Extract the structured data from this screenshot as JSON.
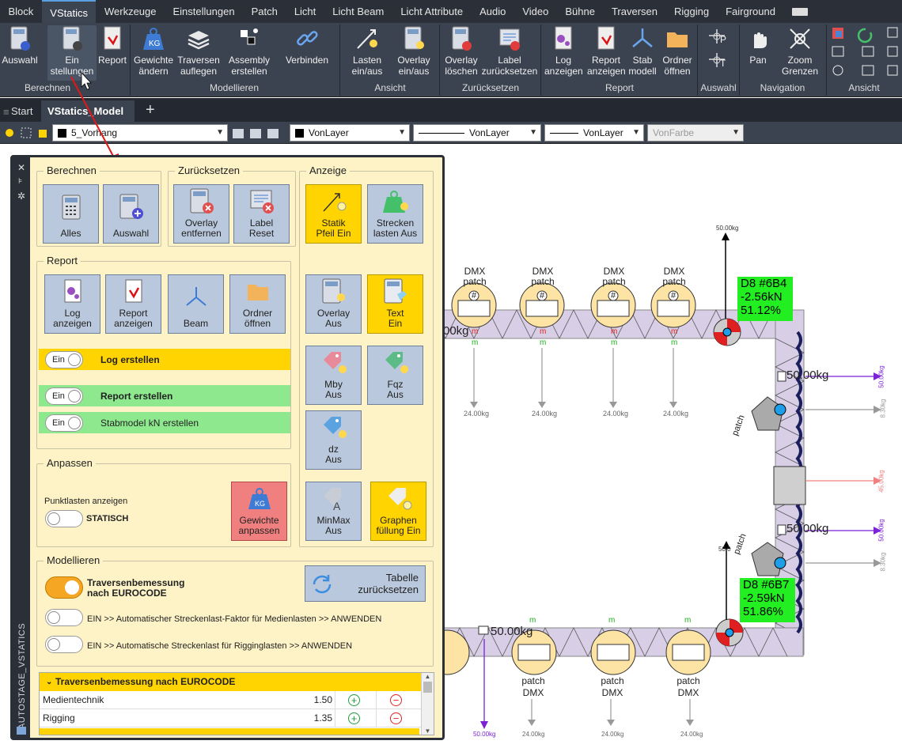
{
  "menu": [
    "Block",
    "VStatics",
    "Werkzeuge",
    "Einstellungen",
    "Patch",
    "Licht",
    "Licht Beam",
    "Licht Attribute",
    "Audio",
    "Video",
    "Bühne",
    "Traversen",
    "Rigging",
    "Fairground"
  ],
  "ribbon": {
    "buttons": [
      "Auswahl",
      "Ein",
      "stellungen",
      "Report",
      "Gewichte",
      "ändern",
      "Traversen",
      "auflegen",
      "Assembly",
      "erstellen",
      "Verbinden",
      "Lasten",
      "ein/aus",
      "Overlay",
      "ein/aus",
      "Overlay",
      "löschen",
      "Label",
      "zurücksetzen",
      "Log",
      "anzeigen",
      "Report",
      "anzeigen",
      "Stab",
      "modell",
      "Ordner",
      "öffnen",
      "Pan",
      "Zoom",
      "Grenzen"
    ],
    "groups": [
      "Berechnen",
      "Modellieren",
      "Ansicht",
      "Zurücksetzen",
      "Report",
      "Auswahl",
      "Navigation",
      "Ansicht"
    ],
    "ribbon_letters": [
      "P",
      "T"
    ]
  },
  "tabs": [
    "Start",
    "VStatics_Model"
  ],
  "propbar": {
    "layer": "5_Vorhang",
    "color": "VonLayer",
    "linetype": "VonLayer",
    "lineweight": "VonLayer",
    "plotcolor": "VonFarbe"
  },
  "panel": {
    "strip_title": "AUTOSTAGE_VSTATICS",
    "legends": [
      "Berechnen",
      "Zurücksetzen",
      "Anzeige",
      "Report",
      "Anpassen",
      "Modellieren"
    ],
    "berechnen": [
      "Alles",
      "Auswahl"
    ],
    "zuruecksetzen": [
      "Overlay",
      "entfernen",
      "Label",
      "Reset"
    ],
    "anzeige": [
      "Statik",
      "Pfeil Ein",
      "Strecken",
      "lasten Aus",
      "Overlay",
      "Aus",
      "Text",
      "Ein",
      "Mby",
      "Aus",
      "Fqz",
      "Aus",
      "dz",
      "Aus",
      "MinMax",
      "Aus",
      "Graphen",
      "füllung Ein"
    ],
    "report": [
      "Log",
      "anzeigen",
      "Report",
      "anzeigen",
      "Beam",
      "Ordner",
      "öffnen"
    ],
    "toggles": [
      {
        "state": "Ein",
        "label": "Log erstellen",
        "color": "#ffd400"
      },
      {
        "state": "Ein",
        "label": "Report erstellen",
        "color": "#8ee88e"
      },
      {
        "state": "Ein",
        "label": "Stabmodel kN erstellen",
        "color": "#8ee88e"
      }
    ],
    "anpassen": {
      "label": "Punktlasten anzeigen",
      "toggle": "STATISCH",
      "button": [
        "Gewichte",
        "anpassen"
      ]
    },
    "modellieren": {
      "trav": [
        "Traversenbemessung",
        "nach EUROCODE"
      ],
      "tabelle": [
        "Tabelle",
        "zurücksetzen"
      ],
      "opt1": "EIN >> Automatischer Streckenlast-Faktor für Medienlasten >> ANWENDEN",
      "opt2": "EIN >> Automatische Streckenlast für Rigginglasten >> ANWENDEN"
    },
    "table": {
      "header": "Traversenbemessung nach EUROCODE",
      "rows": [
        {
          "name": "Medientechnik",
          "value": "1.50"
        },
        {
          "name": "Rigging",
          "value": "1.35"
        }
      ]
    }
  },
  "drawing": {
    "fixture_top": [
      "DMX",
      "patch",
      "DMX",
      "patch",
      "DMX",
      "patch",
      "DMX",
      "patch"
    ],
    "loads": [
      "24.00kg",
      "24.00kg",
      "24.00kg",
      "24.00kg"
    ],
    "top_load": "50.00kg",
    "label1": [
      "D8",
      "#6B4",
      "-2.56kN",
      "51.12%"
    ],
    "label2": [
      "D8",
      "#6B7",
      "-2.59kN",
      "51.86%"
    ],
    "side_loads": [
      "50.00kg",
      "50.00kg"
    ],
    "right_texts": [
      "50.00kg",
      "8.30kg",
      "45.00kg",
      "50.00kg",
      "8.30kg"
    ],
    "bottom_loads": [
      "50.00kg",
      "24.00kg",
      "24.00kg",
      "24.00kg",
      "24.00kg"
    ],
    "bottom_patch": [
      "patch",
      "DMX",
      "patch",
      "DMX",
      "patch",
      "DMX",
      "patch",
      "DMX"
    ],
    "patch_side": [
      "patch",
      "patch"
    ],
    "left_partial": [
      "00kg",
      "50.0"
    ],
    "pin": "#",
    "m": "m",
    "mid_left": "50.00kg"
  }
}
